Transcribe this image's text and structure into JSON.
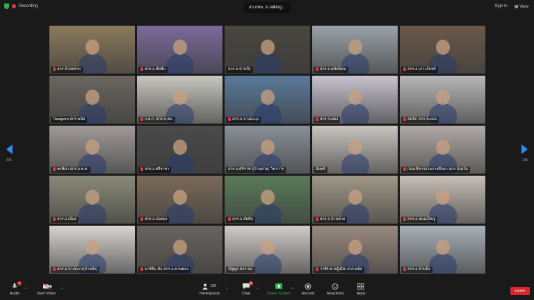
{
  "topbar": {
    "recording_label": "Recording",
    "speaking_label": "สว.กทม. is talking...",
    "sign_in_label": "Sign in",
    "view_label": "View"
  },
  "navigation": {
    "left_page": "3/5",
    "right_page": "3/5"
  },
  "tiles": [
    {
      "label": "สกร.ห้วยทราย",
      "muted": true,
      "bg": "#8a7a5a"
    },
    {
      "label": "สกร.อ.สัตหีบ",
      "muted": true,
      "bg": "#7a6a9a"
    },
    {
      "label": "สกร.อ.บ้านบึง",
      "muted": false,
      "bg": "#4a4640"
    },
    {
      "label": "สกร.อ.พนัสนิคม",
      "muted": true,
      "bg": "#9aa2a8"
    },
    {
      "label": "สกร.อ.เกาะจันทร์",
      "muted": true,
      "bg": "#6a5a4a"
    },
    {
      "label": "Tanaporn สกร.พนัส",
      "muted": false,
      "bg": "#6a6660"
    },
    {
      "label": "ก.ต.ก. สกร.จ.ชบ.",
      "muted": true,
      "bg": "#c9c6c0"
    },
    {
      "label": "สกร.อ.บางละมุง",
      "muted": true,
      "bg": "#5a7a9a"
    },
    {
      "label": "สกร.ระยอง",
      "muted": true,
      "bg": "#c8c2d0"
    },
    {
      "label": "สมนึก สกร.ระยอง",
      "muted": true,
      "bg": "#b8b8b8"
    },
    {
      "label": "พรชิตา สกร.อ.พ.ท.",
      "muted": true,
      "bg": "#a09a98"
    },
    {
      "label": "สกร.อ.ศรีราชา",
      "muted": true,
      "bg": "#4a4a4a"
    },
    {
      "label": "สกร.อ.ศรีราชา(บ้านค่าย) วิชาการ",
      "muted": false,
      "bg": "#8a9098"
    },
    {
      "label": "จันทร์",
      "muted": false,
      "bg": "#c9c6c0"
    },
    {
      "label": "กองบริหารงานการศึกษา สกร.จังหวัด",
      "muted": true,
      "bg": "#b0aaa6"
    },
    {
      "label": "สกร.อ.เมือง",
      "muted": true,
      "bg": "#8a8a7a"
    },
    {
      "label": "สกร.อ.บ่อทอง",
      "muted": true,
      "bg": "#7a6a5a"
    },
    {
      "label": "สกร.อ.สัตหีบ",
      "muted": true,
      "bg": "#5a7a5a"
    },
    {
      "label": "สกร.อ.บ้านค่าย",
      "muted": true,
      "bg": "#a09888"
    },
    {
      "label": "สกร.อ.หนองใหญ่",
      "muted": true,
      "bg": "#c8c0b8"
    },
    {
      "label": "สกร.อ.บางปะกง(บ้านบึง)",
      "muted": true,
      "bg": "#d8d4d0"
    },
    {
      "label": "มาร์ติน คิอ สกร.อ.พานทอง",
      "muted": true,
      "bg": "#6a6460"
    },
    {
      "label": "ณัฐพูล สกร.จบ.",
      "muted": false,
      "bg": "#d0ccc8"
    },
    {
      "label": "ว่าที่ร.ต.หญิงนิด สกร.พนัส",
      "muted": true,
      "bg": "#9a8a80"
    },
    {
      "label": "สกร.อ.บ้านบึง",
      "muted": true,
      "bg": "#a8b0b8"
    }
  ],
  "toolbar": {
    "audio_label": "Audio",
    "video_label": "Start Video",
    "participants_label": "Participants",
    "participants_count": "169",
    "chat_label": "Chat",
    "chat_badge": "9",
    "share_label": "Share Screen",
    "record_label": "Record",
    "reactions_label": "Reactions",
    "apps_label": "Apps",
    "leave_label": "Leave"
  },
  "colors": {
    "accent": "#2a8cff",
    "share_green": "#2db34a",
    "leave_red": "#d7262d",
    "mute_red": "#e03a3a"
  }
}
